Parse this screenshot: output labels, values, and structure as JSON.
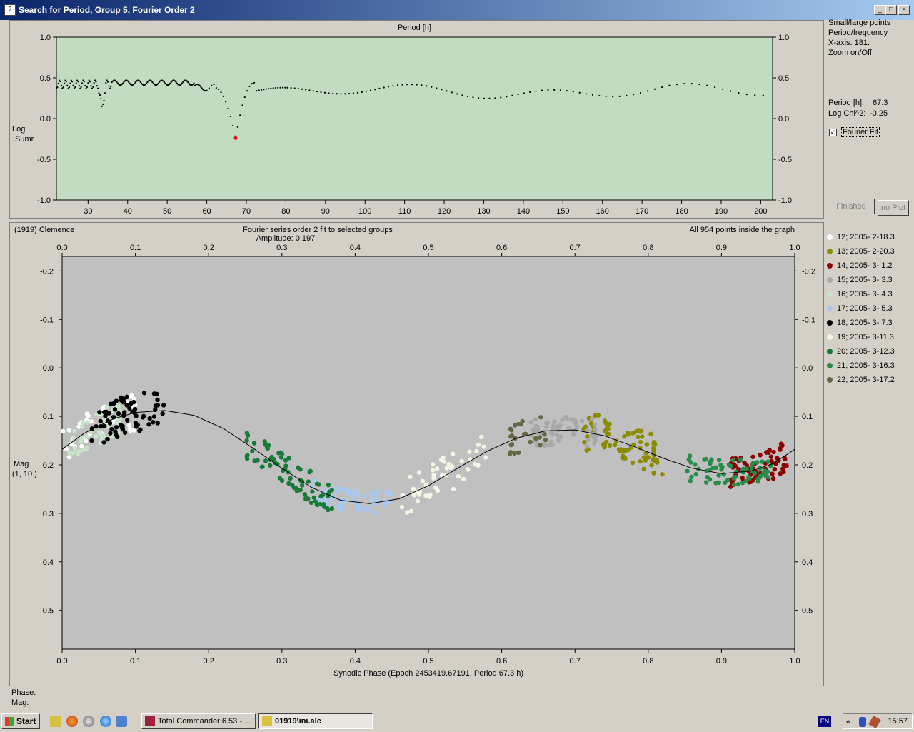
{
  "window": {
    "title": "Search for Period, Group 5, Fourier Order 2",
    "app_icon": "7",
    "controls": {
      "minimize": "_",
      "maximize": "□",
      "close": "×",
      "extra": "?"
    }
  },
  "side_panel": {
    "lines": [
      "Small/large points",
      "Period/frequency",
      "X-axis: 181.",
      "Zoom on/Off"
    ],
    "period_label": "Period [h]:",
    "period_value": "67.3",
    "chi_label": "Log Chi^2:",
    "chi_value": "-0.25",
    "fourier_fit_label": "Fourier Fit",
    "fourier_fit_checked": "✓",
    "finished_button": "Finished",
    "noplot_button": "no Plot"
  },
  "chart_data": [
    {
      "type": "scatter",
      "title": "Period [h]",
      "ylabel_line1": "Log",
      "ylabel_line2": "Sumr",
      "xlim": [
        22,
        203
      ],
      "ylim": [
        -1,
        1
      ],
      "x_ticks": [
        30,
        40,
        50,
        60,
        70,
        80,
        90,
        100,
        110,
        120,
        130,
        140,
        150,
        160,
        170,
        180,
        190,
        200
      ],
      "y_ticks": [
        1.0,
        0.5,
        0.0,
        -0.5,
        -1.0
      ],
      "y_tick_labels": [
        "1.0",
        "0.5",
        "0.0",
        "-0.5",
        "-1.0"
      ],
      "reference_line_y": -0.25,
      "selected_point": {
        "x": 67.3,
        "y": -0.24
      },
      "background": "#c2dcc2",
      "marker_color": "#000000",
      "selected_color": "#e01010"
    },
    {
      "type": "scatter",
      "object_label": "(1919) Clemence",
      "title": "Fourier series order 2 fit to selected groups",
      "subtitle": "Amplitude: 0.197",
      "note": "All 954 points inside the graph",
      "xlabel": "Synodic Phase (Epoch 2453419.67191, Period 67.3 h)",
      "ylabel_line1": "Mag",
      "ylabel_line2": "(1, 10.)",
      "xlim": [
        0,
        1
      ],
      "ylim": [
        -0.23,
        0.58
      ],
      "y_inverted": true,
      "x_ticks": [
        0.0,
        0.1,
        0.2,
        0.3,
        0.4,
        0.5,
        0.6,
        0.7,
        0.8,
        0.9,
        1.0
      ],
      "x_tick_labels": [
        "0.0",
        "0.1",
        "0.2",
        "0.3",
        "0.4",
        "0.5",
        "0.6",
        "0.7",
        "0.8",
        "0.9",
        "1.0"
      ],
      "y_ticks": [
        -0.2,
        -0.1,
        0.0,
        0.1,
        0.2,
        0.3,
        0.4,
        0.5
      ],
      "y_tick_labels": [
        "-0.2",
        "-0.1",
        "0.0",
        "0.1",
        "0.2",
        "0.3",
        "0.4",
        "0.5"
      ],
      "background": "#c0c0c0",
      "fit_curve": [
        {
          "x": 0.0,
          "y": 0.168
        },
        {
          "x": 0.03,
          "y": 0.135
        },
        {
          "x": 0.07,
          "y": 0.105
        },
        {
          "x": 0.1,
          "y": 0.092
        },
        {
          "x": 0.14,
          "y": 0.088
        },
        {
          "x": 0.18,
          "y": 0.098
        },
        {
          "x": 0.22,
          "y": 0.125
        },
        {
          "x": 0.26,
          "y": 0.165
        },
        {
          "x": 0.3,
          "y": 0.207
        },
        {
          "x": 0.34,
          "y": 0.246
        },
        {
          "x": 0.38,
          "y": 0.273
        },
        {
          "x": 0.42,
          "y": 0.28
        },
        {
          "x": 0.46,
          "y": 0.27
        },
        {
          "x": 0.5,
          "y": 0.243
        },
        {
          "x": 0.54,
          "y": 0.207
        },
        {
          "x": 0.58,
          "y": 0.172
        },
        {
          "x": 0.62,
          "y": 0.145
        },
        {
          "x": 0.66,
          "y": 0.13
        },
        {
          "x": 0.7,
          "y": 0.128
        },
        {
          "x": 0.74,
          "y": 0.14
        },
        {
          "x": 0.78,
          "y": 0.162
        },
        {
          "x": 0.82,
          "y": 0.186
        },
        {
          "x": 0.86,
          "y": 0.207
        },
        {
          "x": 0.9,
          "y": 0.218
        },
        {
          "x": 0.94,
          "y": 0.213
        },
        {
          "x": 0.97,
          "y": 0.198
        },
        {
          "x": 1.0,
          "y": 0.168
        }
      ],
      "series": [
        {
          "name": "12; 2005- 2-18.3",
          "color": "#ffffff",
          "x_range": [
            0.0,
            0.1
          ],
          "y_center": 0.13,
          "spread": 0.05,
          "count": 40
        },
        {
          "name": "13; 2005- 2-20.3",
          "color": "#8b8b00",
          "x_range": [
            0.71,
            0.82
          ],
          "y_center": 0.16,
          "spread": 0.05,
          "count": 80
        },
        {
          "name": "14; 2005- 3- 1.2",
          "color": "#8b0000",
          "x_range": [
            0.91,
            0.99
          ],
          "y_center": 0.205,
          "spread": 0.04,
          "count": 70
        },
        {
          "name": "15; 2005- 3- 3.3",
          "color": "#a8a8a8",
          "x_range": [
            0.64,
            0.73
          ],
          "y_center": 0.12,
          "spread": 0.04,
          "count": 70
        },
        {
          "name": "16; 2005- 3- 4.3",
          "color": "#c8e4c8",
          "x_range": [
            0.01,
            0.08
          ],
          "y_center": 0.13,
          "spread": 0.05,
          "count": 50
        },
        {
          "name": "17; 2005- 3- 5.3",
          "color": "#a8c8f0",
          "x_range": [
            0.34,
            0.45
          ],
          "y_center": 0.28,
          "spread": 0.03,
          "count": 70
        },
        {
          "name": "18; 2005- 3- 7.3",
          "color": "#000000",
          "x_range": [
            0.04,
            0.14
          ],
          "y_center": 0.11,
          "spread": 0.05,
          "count": 70
        },
        {
          "name": "19; 2005- 3-11.3",
          "color": "#f5f5e6",
          "x_range": [
            0.46,
            0.58
          ],
          "y_center": 0.23,
          "spread": 0.05,
          "count": 50
        },
        {
          "name": "20; 2005- 3-12.3",
          "color": "#1a7a3a",
          "x_range": [
            0.25,
            0.37
          ],
          "y_center": 0.21,
          "spread": 0.04,
          "count": 80
        },
        {
          "name": "21; 2005- 3-16.3",
          "color": "#2a8a4a",
          "x_range": [
            0.85,
            0.97
          ],
          "y_center": 0.215,
          "spread": 0.035,
          "count": 70
        },
        {
          "name": "22; 2005- 3-17.2",
          "color": "#666644",
          "x_range": [
            0.61,
            0.66
          ],
          "y_center": 0.15,
          "spread": 0.04,
          "count": 25
        }
      ]
    }
  ],
  "status": {
    "phase_label": "Phase:",
    "mag_label": "Mag:"
  },
  "taskbar": {
    "start_label": "Start",
    "tasks": [
      "Total Commander 6.53 - ...",
      "01919\\ini.alc"
    ],
    "lang": "EN",
    "tray_chevron": "«",
    "clock": "15:57"
  }
}
